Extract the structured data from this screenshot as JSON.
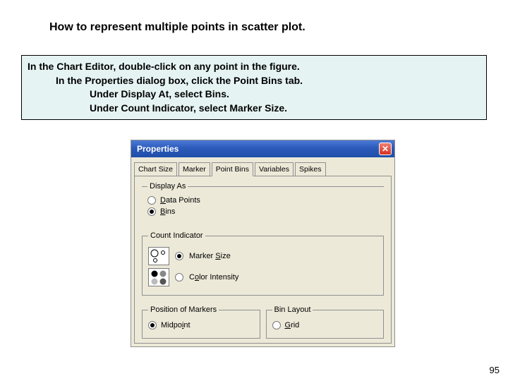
{
  "title": "How to represent multiple points in scatter plot.",
  "instructions": {
    "line1": "In the Chart Editor, double-click on any point in the figure.",
    "line2": "In the Properties dialog box, click the Point Bins tab.",
    "line3": "Under Display At, select Bins.",
    "line4": "Under Count Indicator, select Marker Size."
  },
  "dialog": {
    "title": "Properties",
    "tabs": [
      "Chart Size",
      "Marker",
      "Point Bins",
      "Variables",
      "Spikes"
    ],
    "displayAs": {
      "legend": "Display As",
      "opt1_pre": "D",
      "opt1_post": "ata Points",
      "opt2_pre": "B",
      "opt2_post": "ins"
    },
    "countIndicator": {
      "legend": "Count Indicator",
      "opt1_pre": "Marker ",
      "opt1_u": "S",
      "opt1_post": "ize",
      "opt2_pre": "C",
      "opt2_u": "o",
      "opt2_post": "lor Intensity"
    },
    "positionMarkers": {
      "legend": "Position of Markers",
      "opt_pre": "Midpo",
      "opt_u": "i",
      "opt_post": "nt"
    },
    "binLayout": {
      "legend": "Bin Layout",
      "opt_u": "G",
      "opt_post": "rid"
    }
  },
  "pageNumber": "95"
}
